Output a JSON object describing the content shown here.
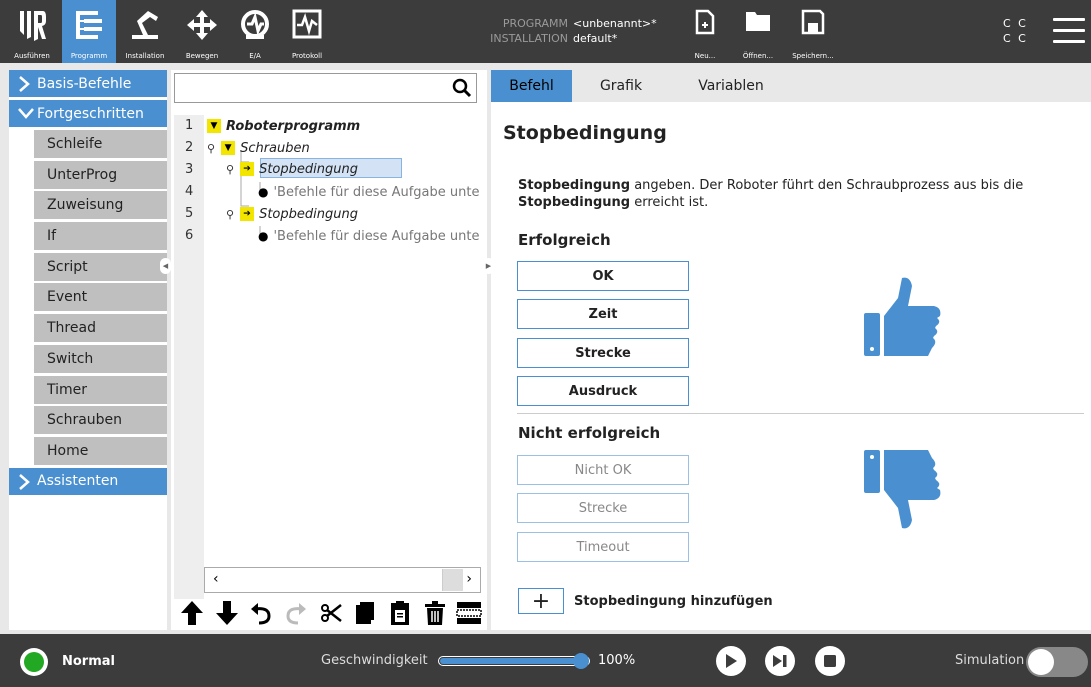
{
  "header": {
    "tabs": [
      {
        "label": "Ausführen",
        "icon": "ur-logo-icon",
        "active": false
      },
      {
        "label": "Programm",
        "icon": "program-icon",
        "active": true
      },
      {
        "label": "Installation",
        "icon": "installation-icon",
        "active": false
      },
      {
        "label": "Bewegen",
        "icon": "move-icon",
        "active": false
      },
      {
        "label": "E/A",
        "icon": "io-icon",
        "active": false
      },
      {
        "label": "Protokoll",
        "icon": "log-icon",
        "active": false
      }
    ],
    "program_key": "PROGRAMM",
    "program_value": "<unbenannt>*",
    "installation_key": "INSTALLATION",
    "installation_value": "default*",
    "file_buttons": [
      {
        "label": "Neu...",
        "icon": "new-file-icon"
      },
      {
        "label": "Öffnen...",
        "icon": "open-folder-icon"
      },
      {
        "label": "Speichern...",
        "icon": "save-icon"
      }
    ],
    "cc_top": "C C",
    "cc_bottom": "C C"
  },
  "nav": {
    "basis": "Basis-Befehle",
    "fortgeschritten": "Fortgeschritten",
    "items": [
      "Schleife",
      "UnterProg",
      "Zuweisung",
      "If",
      "Script",
      "Event",
      "Thread",
      "Switch",
      "Timer",
      "Schrauben",
      "Home"
    ],
    "assistenten": "Assistenten"
  },
  "tree": {
    "search_placeholder": "",
    "line_numbers": [
      "1",
      "2",
      "3",
      "4",
      "5",
      "6"
    ],
    "rows": [
      {
        "text": "Roboterprogramm"
      },
      {
        "text": "Schrauben"
      },
      {
        "text": "Stopbedingung"
      },
      {
        "text": "'Befehle für diese Aufgabe unte"
      },
      {
        "text": "Stopbedingung"
      },
      {
        "text": "'Befehle für diese Aufgabe unte"
      }
    ],
    "badge_triangle": "▼",
    "badge_arrow": "➔"
  },
  "panel": {
    "tabs": [
      "Befehl",
      "Grafik",
      "Variablen"
    ],
    "active_tab": "Befehl",
    "title": "Stopbedingung",
    "desc_bold1": "Stopbedingung",
    "desc_part1": " angeben. Der Roboter führt den Schraubprozess aus bis die ",
    "desc_bold2": "Stopbedingung",
    "desc_part2": " erreicht ist.",
    "success_label": "Erfolgreich",
    "success_buttons": [
      "OK",
      "Zeit",
      "Strecke",
      "Ausdruck"
    ],
    "fail_label": "Nicht erfolgreich",
    "fail_buttons": [
      "Nicht OK",
      "Strecke",
      "Timeout"
    ],
    "add_symbol": "+",
    "add_label": "Stopbedingung hinzufügen",
    "accent_color": "#4a90d0"
  },
  "footer": {
    "status": "Normal",
    "status_color": "#22a822",
    "speed_label": "Geschwindigkeit",
    "speed_value": "100%",
    "speed_fraction": 1.0,
    "sim_label": "Simulation"
  }
}
